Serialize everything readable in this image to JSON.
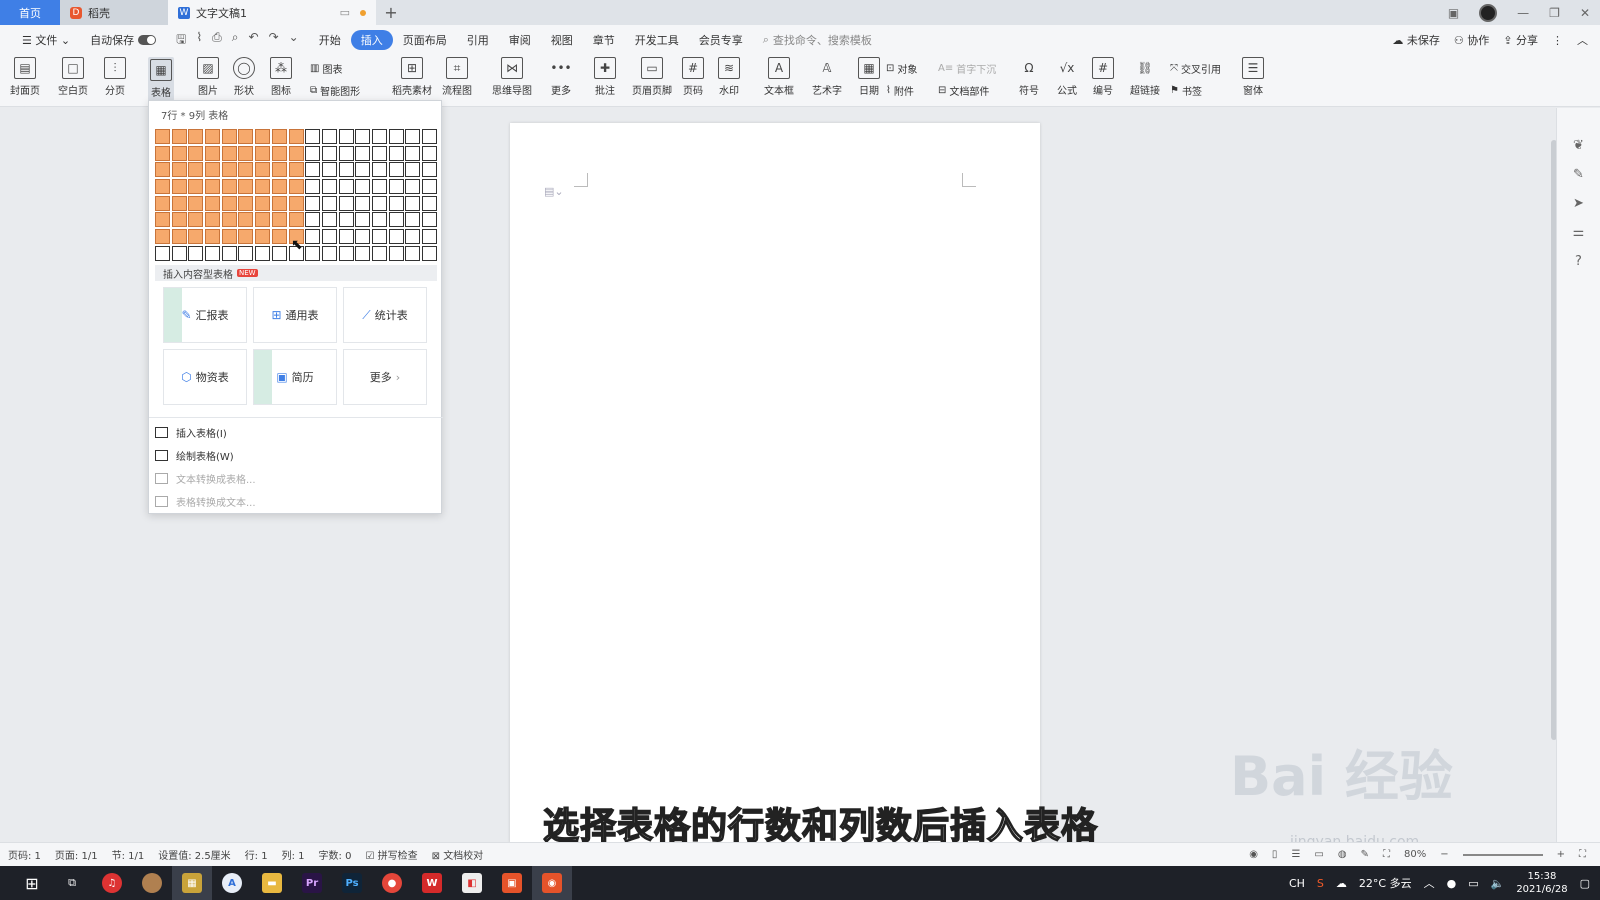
{
  "tabs": {
    "home": "首页",
    "daoke": "稻壳",
    "doc": "文字文稿1"
  },
  "menubar": {
    "file": "文件",
    "autosave": "自动保存",
    "items": [
      "开始",
      "插入",
      "页面布局",
      "引用",
      "审阅",
      "视图",
      "章节",
      "开发工具",
      "会员专享"
    ],
    "active": "插入",
    "search_placeholder": "查找命令、搜索模板",
    "unsaved": "未保存",
    "collab": "协作",
    "share": "分享"
  },
  "ribbon": {
    "cover": "封面页",
    "blank": "空白页",
    "pagebreak": "分页",
    "table": "表格",
    "picture": "图片",
    "shape": "形状",
    "icon": "图标",
    "chart": "图表",
    "smart": "智能图形",
    "daoke_material": "稻壳素材",
    "flowchart": "流程图",
    "mindmap": "思维导图",
    "more": "更多",
    "comment": "批注",
    "header_footer": "页眉页脚",
    "page_number": "页码",
    "watermark": "水印",
    "textbox": "文本框",
    "wordart": "艺术字",
    "date": "日期",
    "object": "对象",
    "attachment": "附件",
    "dropcap": "首字下沉",
    "doc_parts": "文档部件",
    "symbol": "符号",
    "formula": "公式",
    "numbering": "编号",
    "hyperlink": "超链接",
    "crossref": "交叉引用",
    "bookmark": "书签",
    "window": "窗体"
  },
  "dropdown": {
    "size_label": "7行 * 9列 表格",
    "rows_selected": 7,
    "cols_selected": 9,
    "grid_rows": 8,
    "grid_cols": 17,
    "section_label": "插入内容型表格",
    "new_badge": "NEW",
    "templates": [
      "汇报表",
      "通用表",
      "统计表",
      "物资表",
      "简历",
      "更多"
    ],
    "items": [
      {
        "label": "插入表格(I)",
        "enabled": true
      },
      {
        "label": "绘制表格(W)",
        "enabled": true
      },
      {
        "label": "文本转换成表格...",
        "enabled": false
      },
      {
        "label": "表格转换成文本...",
        "enabled": false
      }
    ]
  },
  "subtitle": "选择表格的行数和列数后插入表格",
  "watermark": {
    "brand": "Bai 经验",
    "url": "jingyan.baidu.com"
  },
  "statusbar": {
    "page_num": "页码: 1",
    "pages": "页面: 1/1",
    "section": "节: 1/1",
    "setting": "设置值: 2.5厘米",
    "row": "行: 1",
    "col": "列: 1",
    "words": "字数: 0",
    "spellcheck": "拼写检查",
    "proof": "文档校对",
    "zoom": "80%"
  },
  "taskbar": {
    "weather": "22°C 多云",
    "ime": "CH",
    "time": "15:38",
    "date": "2021/6/28"
  },
  "colors": {
    "accent": "#3f7fe6",
    "grid_selected": "#f6a96c"
  }
}
